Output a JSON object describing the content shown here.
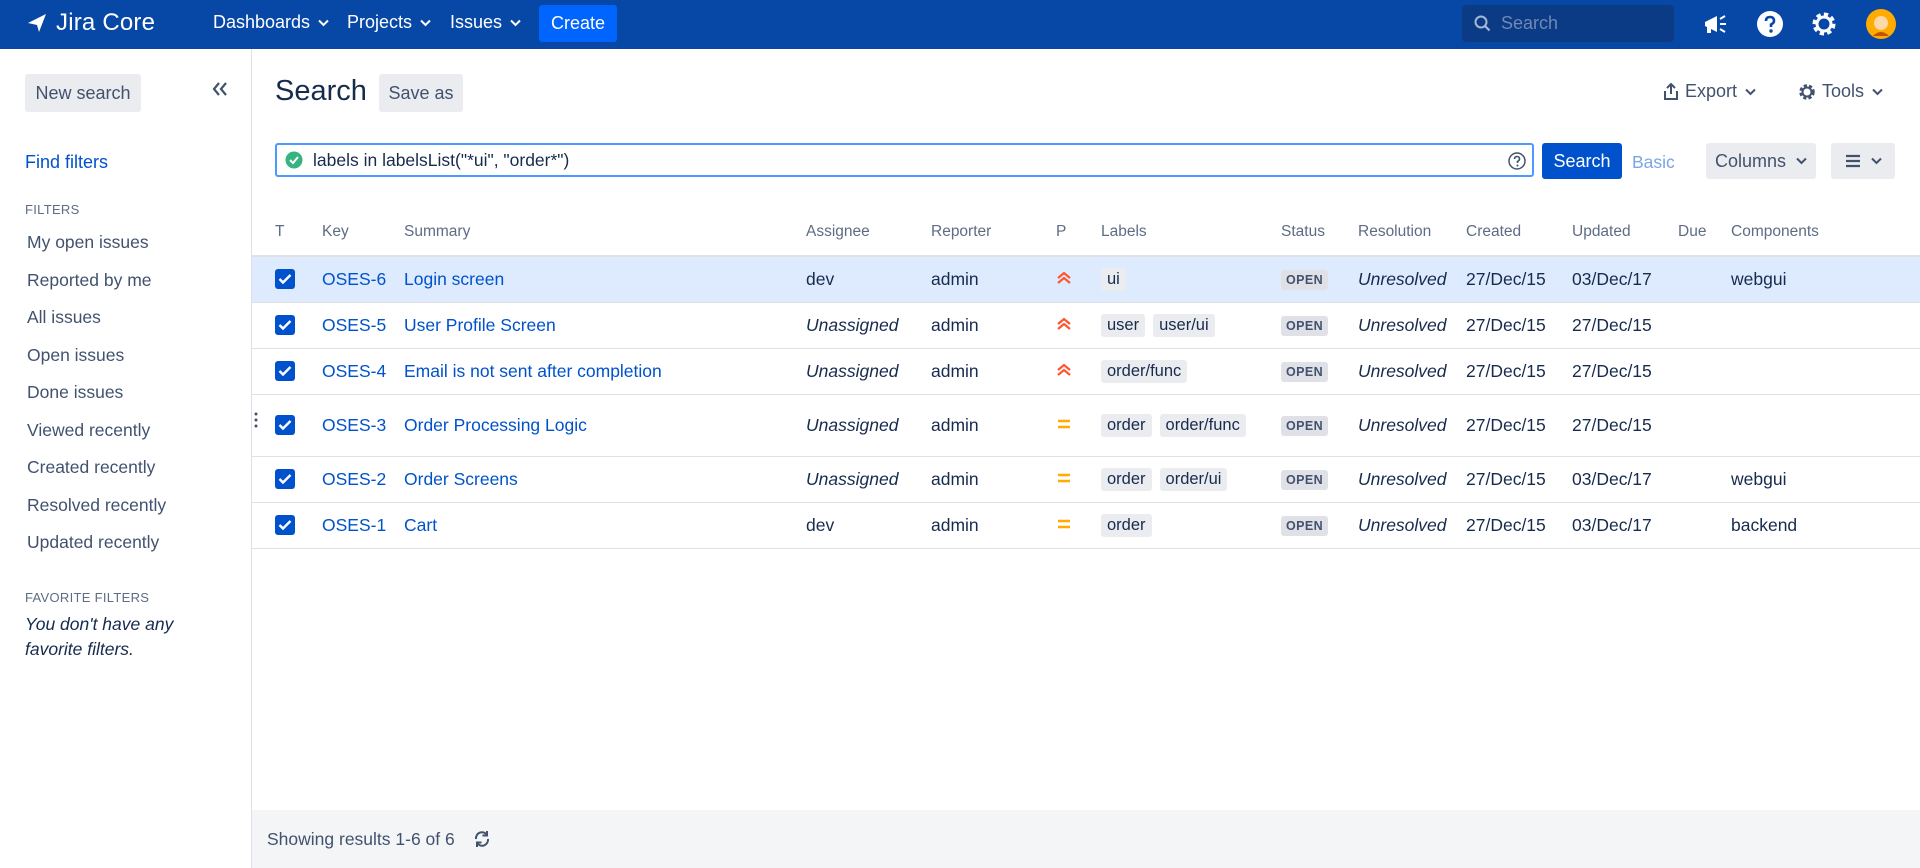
{
  "topnav": {
    "logo_text": "Jira Core",
    "nav": [
      {
        "label": "Dashboards"
      },
      {
        "label": "Projects"
      },
      {
        "label": "Issues"
      }
    ],
    "create_label": "Create",
    "search_placeholder": "Search",
    "brand_color": "#0747a6",
    "icons": [
      "megaphone-icon",
      "help-icon",
      "settings-icon",
      "avatar"
    ]
  },
  "sidebar": {
    "new_search_label": "New search",
    "find_filters_label": "Find filters",
    "filters_heading": "FILTERS",
    "filters": [
      {
        "label": "My open issues"
      },
      {
        "label": "Reported by me"
      },
      {
        "label": "All issues"
      },
      {
        "label": "Open issues"
      },
      {
        "label": "Done issues"
      },
      {
        "label": "Viewed recently"
      },
      {
        "label": "Created recently"
      },
      {
        "label": "Resolved recently"
      },
      {
        "label": "Updated recently"
      }
    ],
    "favorites_heading": "FAVORITE FILTERS",
    "no_favorites_text": "You don't have any favorite filters."
  },
  "main": {
    "title": "Search",
    "save_as_label": "Save as",
    "export_label": "Export",
    "tools_label": "Tools",
    "jql_query": "labels in labelsList(\"*ui\", \"order*\")",
    "search_button_label": "Search",
    "basic_label": "Basic",
    "columns_label": "Columns"
  },
  "table": {
    "headers": {
      "type": "T",
      "key": "Key",
      "summary": "Summary",
      "assignee": "Assignee",
      "reporter": "Reporter",
      "priority": "P",
      "labels": "Labels",
      "status": "Status",
      "resolution": "Resolution",
      "created": "Created",
      "updated": "Updated",
      "due": "Due",
      "components": "Components"
    },
    "rows": [
      {
        "key": "OSES-6",
        "summary": "Login screen",
        "assignee": "dev",
        "reporter": "admin",
        "priority": "high",
        "labels": [
          "ui"
        ],
        "status": "OPEN",
        "resolution": "Unresolved",
        "created": "27/Dec/15",
        "updated": "03/Dec/17",
        "due": "",
        "components": "webgui"
      },
      {
        "key": "OSES-5",
        "summary": "User Profile Screen",
        "assignee": "Unassigned",
        "reporter": "admin",
        "priority": "high",
        "labels": [
          "user",
          "user/ui"
        ],
        "status": "OPEN",
        "resolution": "Unresolved",
        "created": "27/Dec/15",
        "updated": "27/Dec/15",
        "due": "",
        "components": ""
      },
      {
        "key": "OSES-4",
        "summary": "Email is not sent after completion",
        "assignee": "Unassigned",
        "reporter": "admin",
        "priority": "high",
        "labels": [
          "order/func"
        ],
        "status": "OPEN",
        "resolution": "Unresolved",
        "created": "27/Dec/15",
        "updated": "27/Dec/15",
        "due": "",
        "components": ""
      },
      {
        "key": "OSES-3",
        "summary": "Order Processing Logic",
        "assignee": "Unassigned",
        "reporter": "admin",
        "priority": "medium",
        "labels": [
          "order",
          "order/func"
        ],
        "status": "OPEN",
        "resolution": "Unresolved",
        "created": "27/Dec/15",
        "updated": "27/Dec/15",
        "due": "",
        "components": ""
      },
      {
        "key": "OSES-2",
        "summary": "Order Screens",
        "assignee": "Unassigned",
        "reporter": "admin",
        "priority": "medium",
        "labels": [
          "order",
          "order/ui"
        ],
        "status": "OPEN",
        "resolution": "Unresolved",
        "created": "27/Dec/15",
        "updated": "03/Dec/17",
        "due": "",
        "components": "webgui"
      },
      {
        "key": "OSES-1",
        "summary": "Cart",
        "assignee": "dev",
        "reporter": "admin",
        "priority": "medium",
        "labels": [
          "order"
        ],
        "status": "OPEN",
        "resolution": "Unresolved",
        "created": "27/Dec/15",
        "updated": "03/Dec/17",
        "due": "",
        "components": "backend"
      }
    ],
    "priority_colors": {
      "high": "#ff5630",
      "medium": "#ffab00"
    }
  },
  "footer": {
    "results_text": "Showing results 1-6 of 6"
  }
}
